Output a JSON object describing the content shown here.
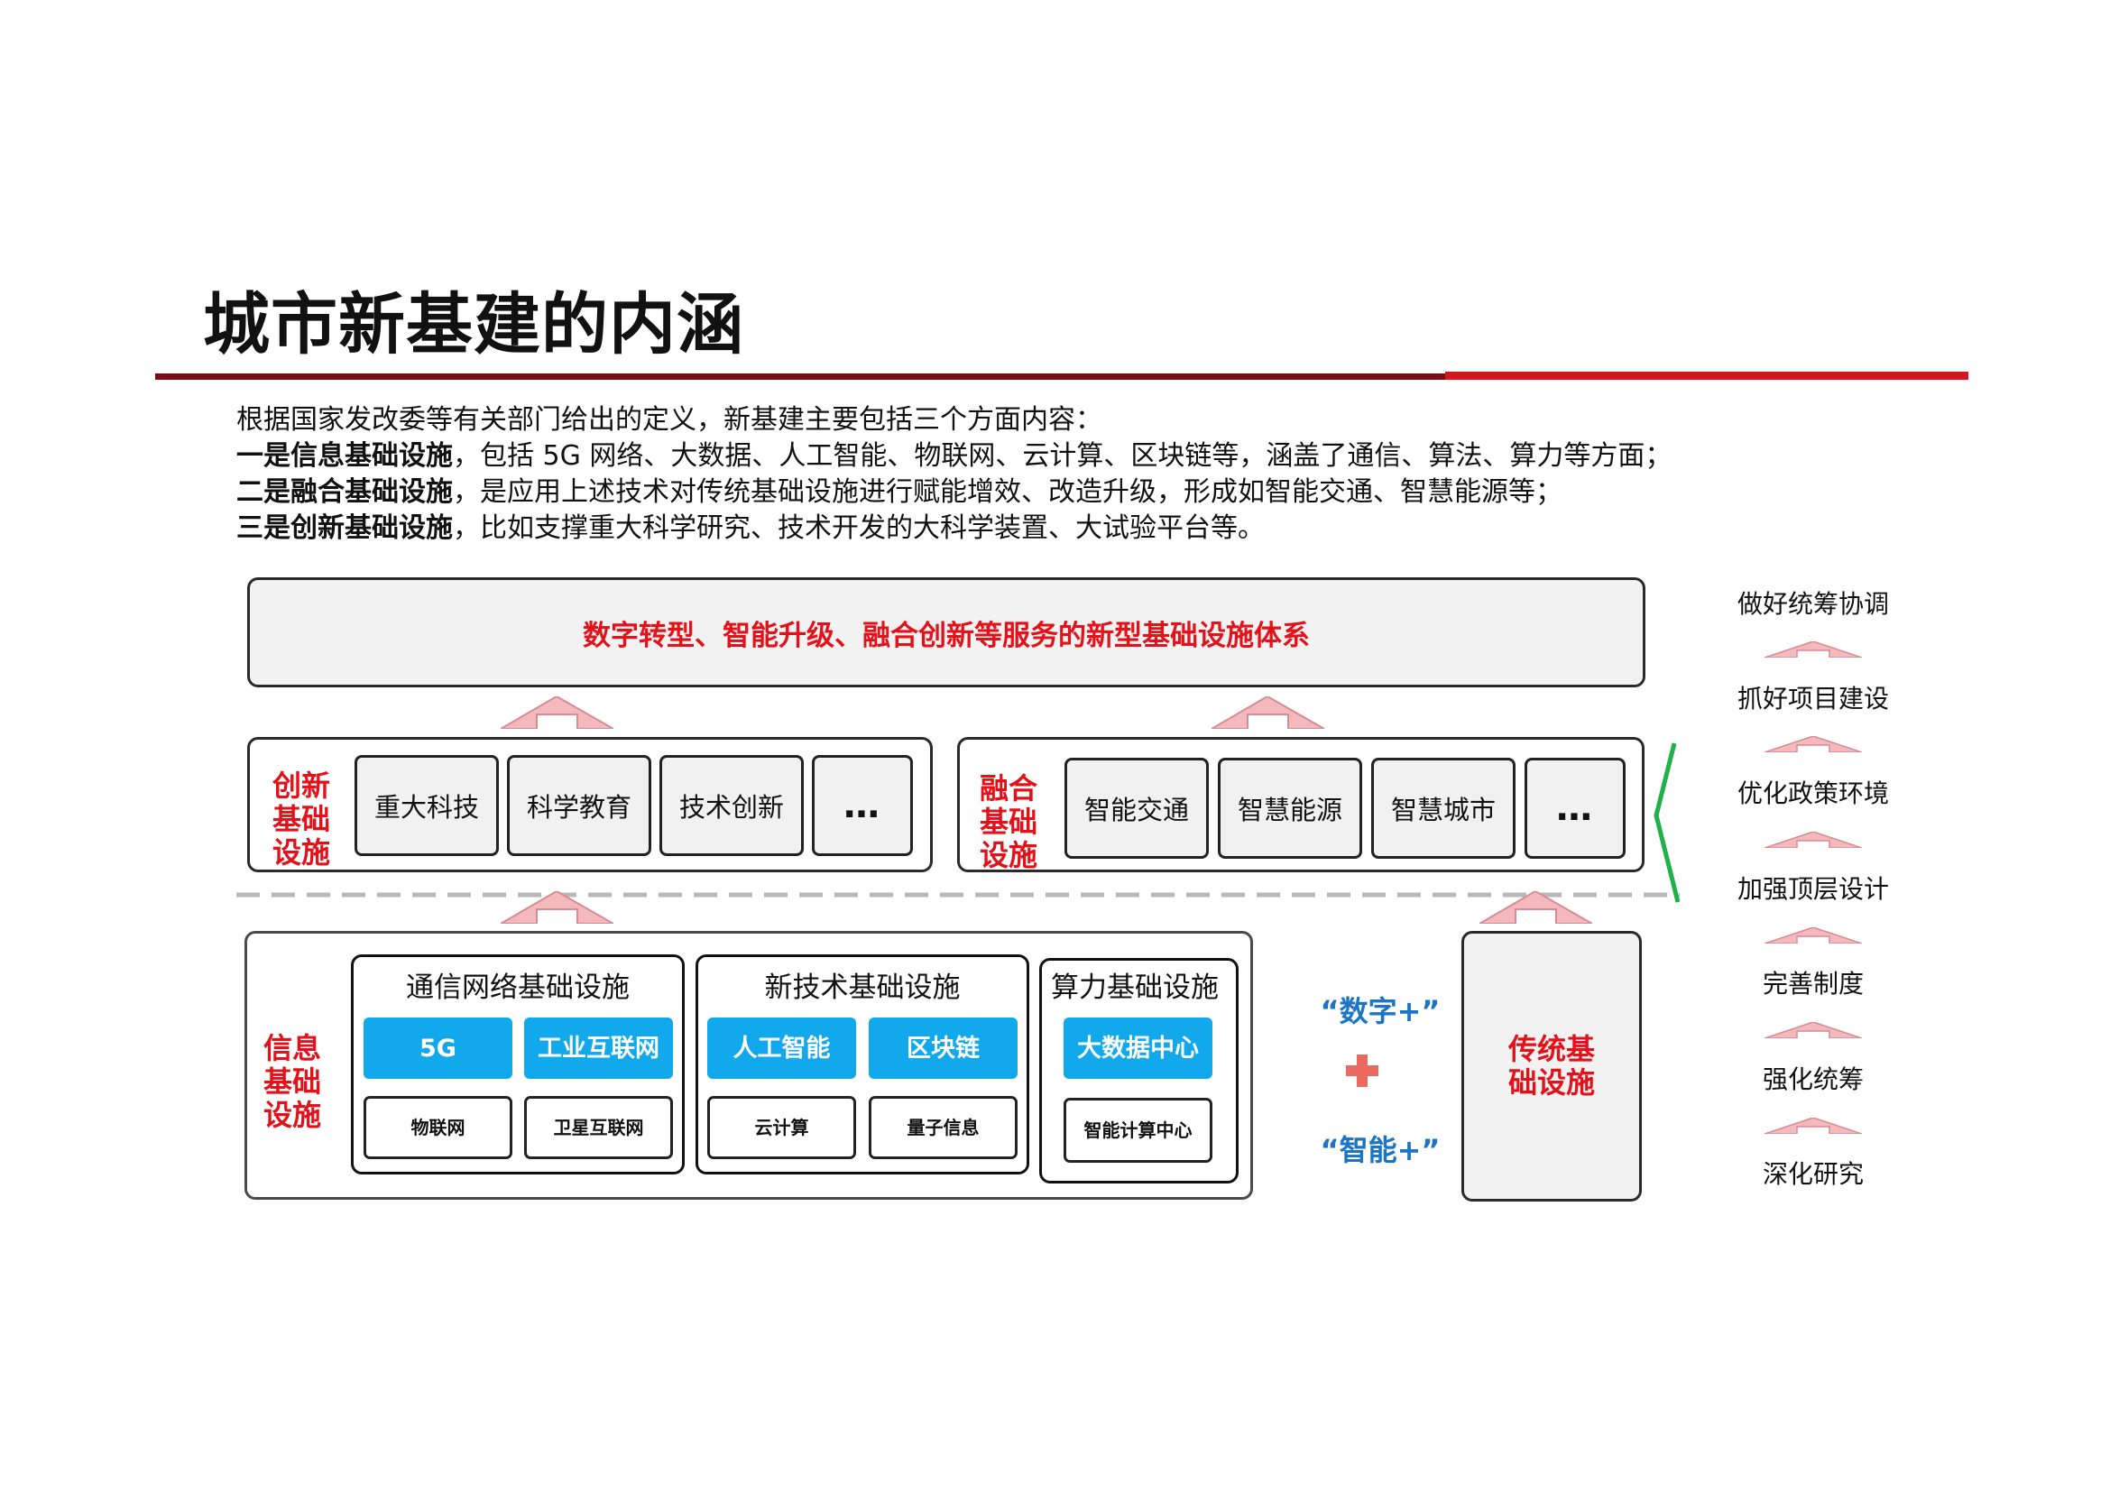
{
  "header": {
    "title": "城市新基建的内涵"
  },
  "intro": {
    "line1": "根据国家发改委等有关部门给出的定义，新基建主要包括三个方面内容：",
    "line2_bold": "一是信息基础设施",
    "line2_rest": "，包括 5G 网络、大数据、人工智能、物联网、云计算、区块链等，涵盖了通信、算法、算力等方面；",
    "line3_bold": "二是融合基础设施",
    "line3_rest": "，是应用上述技术对传统基础设施进行赋能增效、改造升级，形成如智能交通、智慧能源等；",
    "line4_bold": "三是创新基础设施",
    "line4_rest": "，比如支撑重大科学研究、技术开发的大科学装置、大试验平台等。"
  },
  "top_box": {
    "label": "数字转型、智能升级、融合创新等服务的新型基础设施体系"
  },
  "innovation": {
    "label": "创新基础设施",
    "items": [
      "重大科技",
      "科学教育",
      "技术创新",
      "…"
    ]
  },
  "fusion": {
    "label": "融合基础设施",
    "items": [
      "智能交通",
      "智慧能源",
      "智慧城市",
      "…"
    ]
  },
  "info": {
    "label": "信息基础设施",
    "groups": [
      {
        "title": "通信网络基础设施",
        "top": [
          "5G",
          "工业互联网"
        ],
        "bottom": [
          "物联网",
          "卫星互联网"
        ]
      },
      {
        "title": "新技术基础设施",
        "top": [
          "人工智能",
          "区块链"
        ],
        "bottom": [
          "云计算",
          "量子信息"
        ]
      },
      {
        "title": "算力基础设施",
        "top": [
          "大数据中心"
        ],
        "bottom": [
          "智能计算中心"
        ]
      }
    ]
  },
  "middle": {
    "digital": "“数字+”",
    "intelligent": "“智能+”"
  },
  "traditional": {
    "label": "传统基础设施"
  },
  "side_steps": [
    "做好统筹协调",
    "抓好项目建设",
    "优化政策环境",
    "加强顶层设计",
    "完善制度",
    "强化统筹",
    "深化研究"
  ],
  "colors": {
    "red": "#e3121a",
    "dark_red": "#7a0d12",
    "blue": "#12a9ec",
    "text_blue": "#1b74c4",
    "green": "#1fb04a",
    "arrow_pink": "#f3b9bd"
  }
}
